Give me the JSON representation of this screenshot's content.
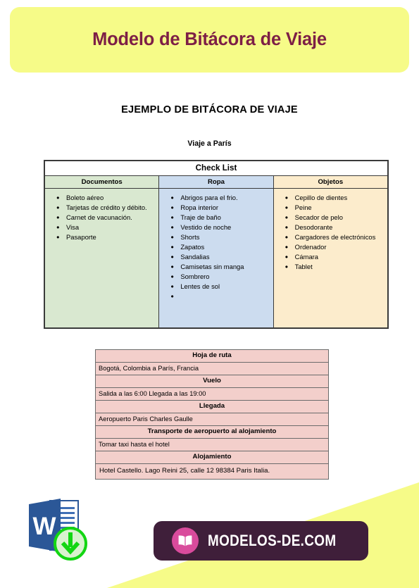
{
  "banner": {
    "title": "Modelo de Bitácora de Viaje",
    "bg_color": "#f6fb88",
    "text_color": "#7d1f46"
  },
  "document": {
    "heading": "EJEMPLO DE BITÁCORA DE VIAJE",
    "subheading": "Viaje a París"
  },
  "checklist": {
    "title": "Check List",
    "columns": [
      {
        "header": "Documentos",
        "color": "#d9e8d0",
        "items": [
          "Boleto aéreo",
          "Tarjetas de crédito y débito.",
          "Carnet de vacunación.",
          "Visa",
          "Pasaporte"
        ]
      },
      {
        "header": "Ropa",
        "color": "#ccdcef",
        "items": [
          "Abrigos para el frio.",
          "Ropa interior",
          "Traje de baño",
          "Vestido de noche",
          "Shorts",
          "Zapatos",
          "Sandalias",
          "Camisetas sin manga",
          "Sombrero",
          "Lentes de sol",
          ""
        ]
      },
      {
        "header": "Objetos",
        "color": "#fceccc",
        "items": [
          "Cepillo de dientes",
          "Peine",
          "Secador de pelo",
          "Desodorante",
          "Cargadores de electrónicos",
          "Ordenador",
          "Cámara",
          "Tablet"
        ]
      }
    ]
  },
  "ruta": {
    "row_color": "#f3cfcb",
    "rows": [
      {
        "type": "header",
        "text": "Hoja de ruta"
      },
      {
        "type": "value",
        "text": "Bogotá, Colombia a París, Francia"
      },
      {
        "type": "header",
        "text": "Vuelo"
      },
      {
        "type": "value",
        "text": "Salida a las 6:00 Llegada a las 19:00"
      },
      {
        "type": "header",
        "text": "Llegada"
      },
      {
        "type": "value",
        "text": "Aeropuerto Paris Charles Gaulle"
      },
      {
        "type": "header",
        "text": "Transporte de aeropuerto al alojamiento"
      },
      {
        "type": "value",
        "text": "Tomar taxi hasta el hotel"
      },
      {
        "type": "header",
        "text": "Alojamiento"
      },
      {
        "type": "value",
        "text": "Hotel Castello. Lago Reini 25, calle 12 98384 Paris Italia."
      }
    ]
  },
  "footer": {
    "word_icon_letter": "W",
    "word_icon_color": "#2b5797",
    "download_arrow_color": "#13d613",
    "logo_text": "MODELOS-DE.COM",
    "logo_bg_color": "#3f1f3a",
    "logo_circle_color": "#d94b9c",
    "wedge_color": "#f6fb88"
  }
}
